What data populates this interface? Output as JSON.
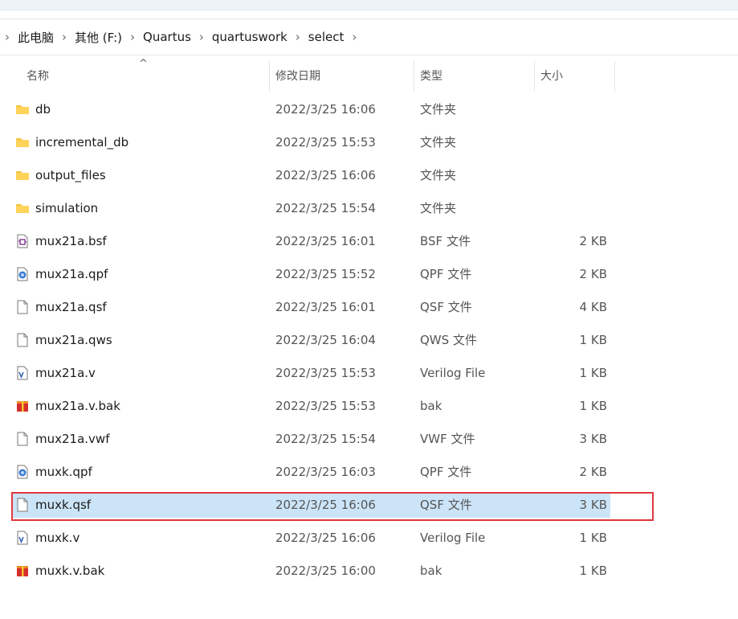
{
  "breadcrumb": [
    "此电脑",
    "其他 (F:)",
    "Quartus",
    "quartuswork",
    "select"
  ],
  "columns": {
    "name": "名称",
    "date": "修改日期",
    "type": "类型",
    "size": "大小"
  },
  "files": [
    {
      "name": "db",
      "date": "2022/3/25 16:06",
      "type": "文件夹",
      "size": "",
      "icon": "folder-icon"
    },
    {
      "name": "incremental_db",
      "date": "2022/3/25 15:53",
      "type": "文件夹",
      "size": "",
      "icon": "folder-icon"
    },
    {
      "name": "output_files",
      "date": "2022/3/25 16:06",
      "type": "文件夹",
      "size": "",
      "icon": "folder-icon"
    },
    {
      "name": "simulation",
      "date": "2022/3/25 15:54",
      "type": "文件夹",
      "size": "",
      "icon": "folder-icon"
    },
    {
      "name": "mux21a.bsf",
      "date": "2022/3/25 16:01",
      "type": "BSF 文件",
      "size": "2 KB",
      "icon": "bsf-file-icon"
    },
    {
      "name": "mux21a.qpf",
      "date": "2022/3/25 15:52",
      "type": "QPF 文件",
      "size": "2 KB",
      "icon": "quartus-project-icon"
    },
    {
      "name": "mux21a.qsf",
      "date": "2022/3/25 16:01",
      "type": "QSF 文件",
      "size": "4 KB",
      "icon": "blank-file-icon"
    },
    {
      "name": "mux21a.qws",
      "date": "2022/3/25 16:04",
      "type": "QWS 文件",
      "size": "1 KB",
      "icon": "blank-file-icon"
    },
    {
      "name": "mux21a.v",
      "date": "2022/3/25 15:53",
      "type": "Verilog File",
      "size": "1 KB",
      "icon": "verilog-file-icon"
    },
    {
      "name": "mux21a.v.bak",
      "date": "2022/3/25 15:53",
      "type": "bak",
      "size": "1 KB",
      "icon": "archive-icon"
    },
    {
      "name": "mux21a.vwf",
      "date": "2022/3/25 15:54",
      "type": "VWF 文件",
      "size": "3 KB",
      "icon": "blank-file-icon"
    },
    {
      "name": "muxk.qpf",
      "date": "2022/3/25 16:03",
      "type": "QPF 文件",
      "size": "2 KB",
      "icon": "quartus-project-icon"
    },
    {
      "name": "muxk.qsf",
      "date": "2022/3/25 16:06",
      "type": "QSF 文件",
      "size": "3 KB",
      "icon": "blank-file-icon",
      "selected": true
    },
    {
      "name": "muxk.v",
      "date": "2022/3/25 16:06",
      "type": "Verilog File",
      "size": "1 KB",
      "icon": "verilog-file-icon"
    },
    {
      "name": "muxk.v.bak",
      "date": "2022/3/25 16:00",
      "type": "bak",
      "size": "1 KB",
      "icon": "archive-icon"
    }
  ],
  "colors": {
    "selected_row": "#cce4f7",
    "highlight_border": "#e0383f",
    "folder": "#f5c242"
  }
}
